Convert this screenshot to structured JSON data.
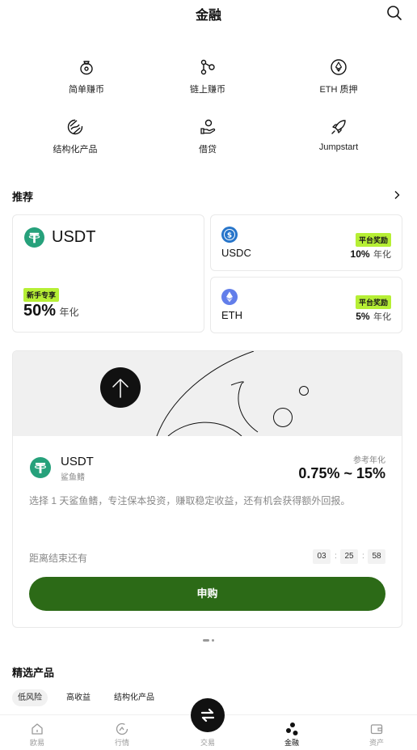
{
  "header": {
    "title": "金融",
    "search_icon": "search-icon"
  },
  "entries": [
    {
      "label": "简单赚币",
      "icon": "money-bag-icon"
    },
    {
      "label": "链上赚币",
      "icon": "nodes-icon"
    },
    {
      "label": "ETH 质押",
      "icon": "ethereum-icon"
    },
    {
      "label": "结构化产品",
      "icon": "structured-icon"
    },
    {
      "label": "借贷",
      "icon": "loan-hand-icon"
    },
    {
      "label": "Jumpstart",
      "icon": "rocket-icon"
    }
  ],
  "recommend": {
    "title": "推荐",
    "cards": [
      {
        "coin": "USDT",
        "tag": "新手专享",
        "apy": "50%",
        "unit": "年化",
        "color": "#26a17b"
      },
      {
        "coin": "USDC",
        "tag": "平台奖励",
        "apy": "10%",
        "unit": "年化",
        "color": "#2775ca"
      },
      {
        "coin": "ETH",
        "tag": "平台奖励",
        "apy": "5%",
        "unit": "年化",
        "color": "#627eea"
      }
    ]
  },
  "feature": {
    "coin": "USDT",
    "subtitle": "鲨鱼鳍",
    "apy_label": "参考年化",
    "apy_range": "0.75% ~ 15%",
    "description": "选择 1 天鲨鱼鳍，专注保本投资，赚取稳定收益，还有机会获得额外回报。",
    "countdown_label": "距离结束还有",
    "countdown": {
      "h": "03",
      "m": "25",
      "s": "58",
      "sep": ":"
    },
    "cta": "申购",
    "accent": "#2c6a17"
  },
  "selected": {
    "title": "精选产品",
    "filters": [
      "低风险",
      "高收益",
      "结构化产品"
    ]
  },
  "tabbar": [
    {
      "label": "欧易",
      "icon": "home-icon"
    },
    {
      "label": "行情",
      "icon": "markets-icon"
    },
    {
      "label": "交易",
      "icon": "trade-swap-icon"
    },
    {
      "label": "金融",
      "icon": "finance-icon"
    },
    {
      "label": "资产",
      "icon": "wallet-icon"
    }
  ]
}
